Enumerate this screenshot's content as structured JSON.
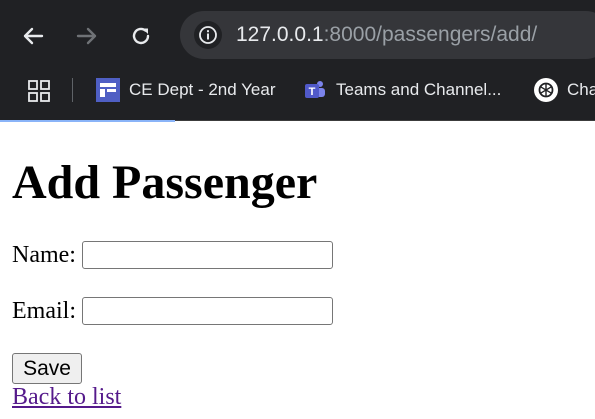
{
  "browser": {
    "url_host": "127.0.0.1",
    "url_path": ":8000/passengers/add/",
    "bookmarks": [
      {
        "label": "CE Dept - 2nd Year",
        "icon": "ce-dept-icon"
      },
      {
        "label": "Teams and Channel...",
        "icon": "teams-icon"
      },
      {
        "label": "Cha",
        "icon": "chatgpt-icon"
      }
    ],
    "colors": {
      "toolbar": "#202124",
      "omnibox": "#35363a",
      "text": "#e8eaed",
      "muted": "#9aa0a6"
    }
  },
  "page": {
    "title": "Add Passenger",
    "form": {
      "name_label": "Name:",
      "name_value": "",
      "email_label": "Email:",
      "email_value": "",
      "save_label": "Save"
    },
    "back_link": "Back to list"
  }
}
